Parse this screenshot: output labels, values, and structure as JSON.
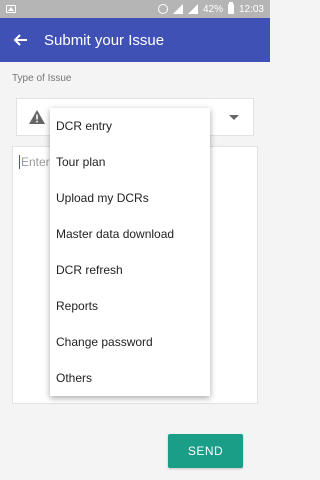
{
  "status_bar": {
    "battery": "42%",
    "time": "12:03",
    "icons": [
      "image-icon",
      "alarm-icon",
      "signal-icon",
      "signal-icon",
      "battery-icon"
    ]
  },
  "app_bar": {
    "title": "Submit your Issue",
    "back_icon": "arrow-left-icon",
    "color": "#3f51b5"
  },
  "form": {
    "type_label": "Type of Issue",
    "details_placeholder": "Enter",
    "send_label": "SEND",
    "send_color": "#1a9e87"
  },
  "menu": {
    "items": [
      "DCR entry",
      "Tour plan",
      "Upload my DCRs",
      "Master data download",
      "DCR refresh",
      "Reports",
      "Change password",
      "Others"
    ]
  }
}
